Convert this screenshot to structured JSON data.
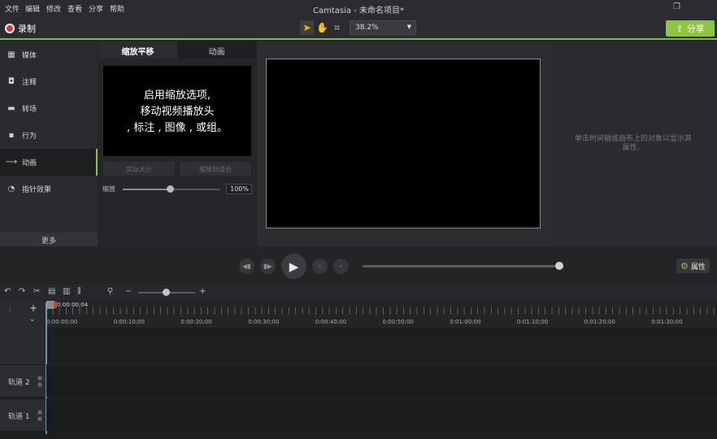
{
  "window": {
    "title": "Camtasia - 未命名项目*"
  },
  "menu": [
    "文件",
    "编辑",
    "修改",
    "查看",
    "分享",
    "帮助"
  ],
  "toolbar": {
    "record_label": "录制",
    "zoom_value": "38.2%",
    "share_label": "分享"
  },
  "left_tabs": [
    {
      "label": "媒体",
      "icon": "film-icon"
    },
    {
      "label": "注释",
      "icon": "callout-icon"
    },
    {
      "label": "转场",
      "icon": "transition-icon"
    },
    {
      "label": "行为",
      "icon": "behavior-icon"
    },
    {
      "label": "动画",
      "icon": "animation-icon"
    },
    {
      "label": "指针效果",
      "icon": "cursor-effect-icon"
    }
  ],
  "active_left_tab": 4,
  "more_label": "更多",
  "mid_panel": {
    "tabs": [
      "缩放平移",
      "动画"
    ],
    "active_tab": 0,
    "preview_lines": [
      "启用缩放选项,",
      "移动视频播放头",
      ", 标注 , 图像 , 或组。"
    ],
    "btn_actual_size": "实际大小",
    "btn_zoom_fit": "缩放到适合",
    "scale_label": "缩放",
    "scale_value": "100%",
    "scale_fraction": 0.48
  },
  "props_hint": "单击时间轴或画布上的对象以显示其属性。",
  "properties_label": "属性",
  "timeline": {
    "playhead_time": "0:00:00;04",
    "ruler": [
      "0:00:00;00",
      "0:00:10;00",
      "0:00:20;00",
      "0:00:30;00",
      "0:00:40;00",
      "0:00:50;00",
      "0:01:00;00",
      "0:01:10;00",
      "0:01:20;00",
      "0:01:30;00"
    ],
    "tracks": [
      "轨道 2",
      "轨道 1"
    ]
  },
  "colors": {
    "accent": "#8dc63f",
    "record": "#e0352b"
  }
}
